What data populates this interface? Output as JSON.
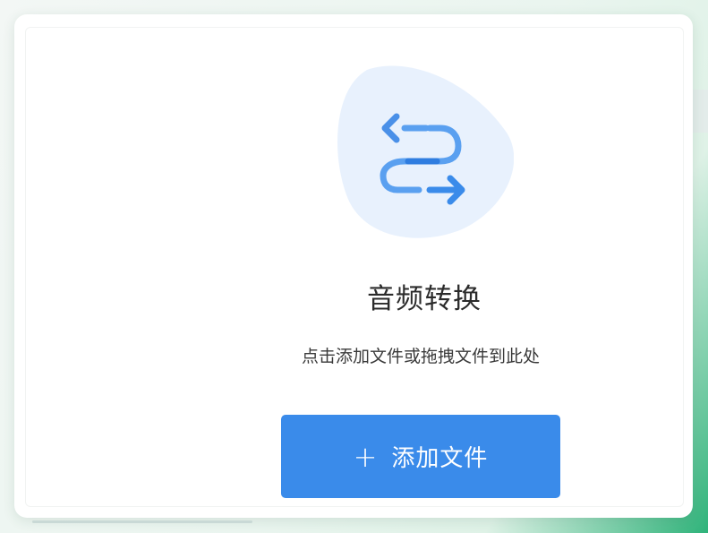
{
  "converter": {
    "icon": "swap-arrows-icon",
    "title": "音频转换",
    "hint": "点击添加文件或拖拽文件到此处",
    "add_button": {
      "icon": "plus-icon",
      "plus_glyph": "+",
      "label": "添加文件"
    }
  },
  "colors": {
    "accent": "#3a8bea",
    "icon_blob": "#e8f1fd",
    "icon_arrow": "#5aa0f0",
    "icon_arrow_dark": "#2f7de0",
    "title_text": "#2b2b2b",
    "card_bg": "#ffffff",
    "backdrop_accent": "#2fb37a"
  }
}
